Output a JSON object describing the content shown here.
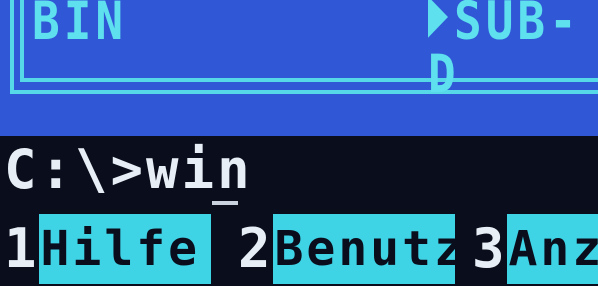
{
  "panels": {
    "left_title": "BIN",
    "right_title": "SUB-D"
  },
  "command_line": {
    "prompt": "C:\\>win"
  },
  "function_keys": [
    {
      "number": "1",
      "label": "Hilfe"
    },
    {
      "number": "2",
      "label": "Benutz"
    },
    {
      "number": "3",
      "label": "Anz"
    }
  ],
  "colors": {
    "panel_background": "#2f57d6",
    "panel_frame": "#57d8e8",
    "key_label_background": "#3fd3e6",
    "text": "#e8eef6",
    "background": "#0a0e1c"
  }
}
